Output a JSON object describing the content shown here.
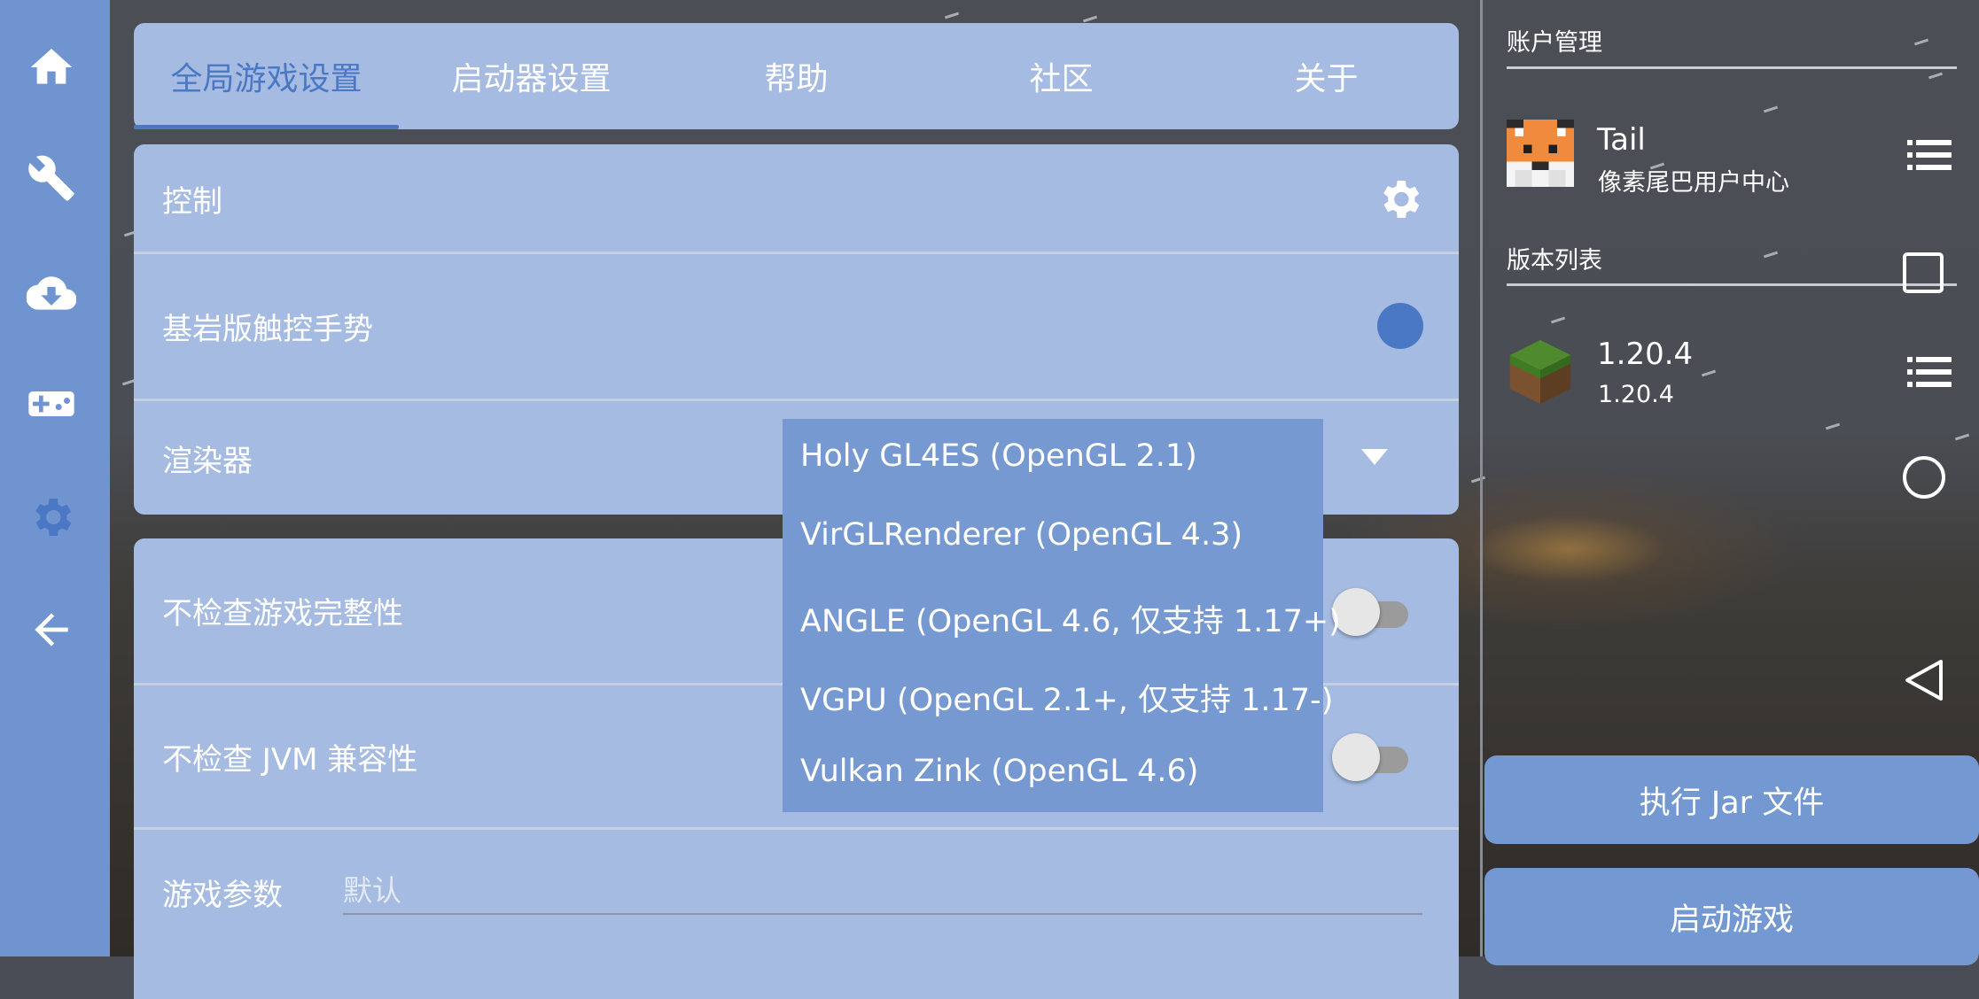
{
  "rail": {
    "icons": [
      "home-icon",
      "wrench-icon",
      "cloud-download-icon",
      "gamepad-icon",
      "gear-icon",
      "back-arrow-icon"
    ],
    "active_color": "#4b78c4"
  },
  "tabs": [
    {
      "label": "全局游戏设置",
      "active": true
    },
    {
      "label": "启动器设置",
      "active": false
    },
    {
      "label": "帮助",
      "active": false
    },
    {
      "label": "社区",
      "active": false
    },
    {
      "label": "关于",
      "active": false
    }
  ],
  "settings": {
    "control": {
      "label": "控制"
    },
    "bedrock_touch": {
      "label": "基岩版触控手势",
      "enabled": true
    },
    "renderer": {
      "label": "渲染器"
    },
    "skip_integrity": {
      "label": "不检查游戏完整性",
      "enabled": false
    },
    "skip_jvm": {
      "label": "不检查 JVM 兼容性",
      "enabled": false
    },
    "game_args": {
      "label": "游戏参数",
      "placeholder": "默认"
    }
  },
  "renderer_options": [
    "Holy GL4ES (OpenGL 2.1)",
    "VirGLRenderer (OpenGL 4.3)",
    "ANGLE (OpenGL 4.6, 仅支持 1.17+)",
    "VGPU (OpenGL 2.1+, 仅支持 1.17-)",
    "Vulkan Zink (OpenGL 4.6)"
  ],
  "account": {
    "section_label": "账户管理",
    "name": "Tail",
    "provider": "像素尾巴用户中心"
  },
  "version": {
    "section_label": "版本列表",
    "name": "1.20.4",
    "sub": "1.20.4"
  },
  "buttons": {
    "run_jar": "执行 Jar 文件",
    "launch": "启动游戏"
  },
  "colors": {
    "rail": "#6f94d0",
    "panel": "#a5bbe2",
    "accent": "#4b78c4",
    "dropdown": "#7799d1",
    "button": "#7398d2"
  }
}
